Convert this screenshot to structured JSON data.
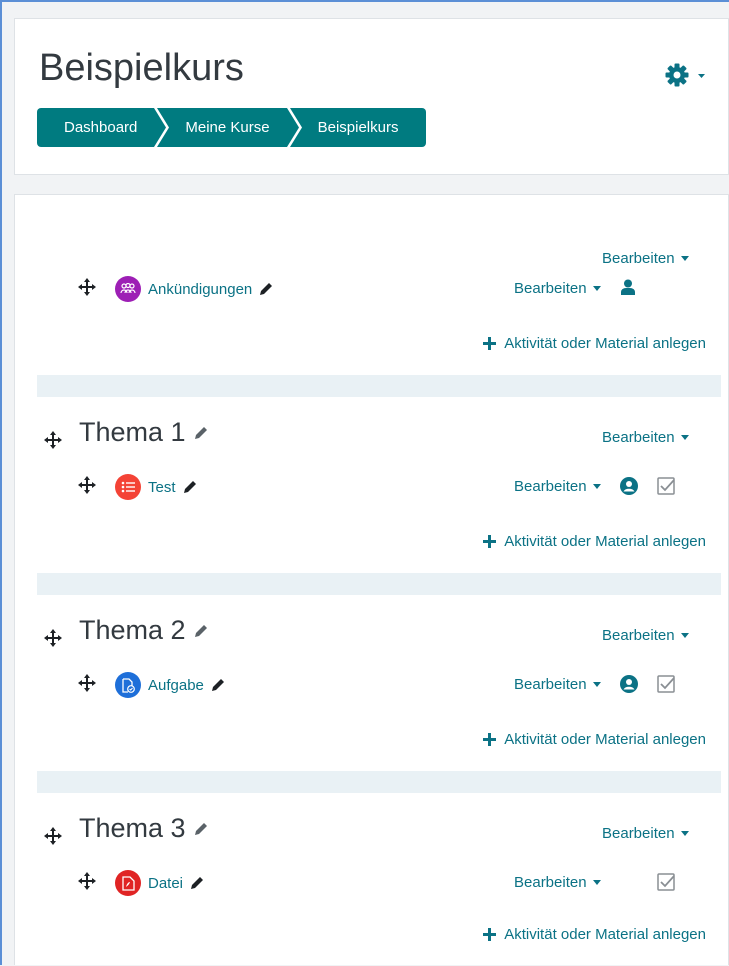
{
  "page": {
    "title": "Beispielkurs"
  },
  "breadcrumb": [
    "Dashboard",
    "Meine Kurse",
    "Beispielkurs"
  ],
  "edit_label": "Bearbeiten",
  "add_label": "Aktivität oder Material anlegen",
  "sections": [
    {
      "title": "",
      "activity": {
        "name": "Ankündigungen",
        "type": "forum",
        "color": "#9d1fb5"
      }
    },
    {
      "title": "Thema 1",
      "activity": {
        "name": "Test",
        "type": "quiz",
        "color": "#f44336"
      }
    },
    {
      "title": "Thema 2",
      "activity": {
        "name": "Aufgabe",
        "type": "assignment",
        "color": "#1e6fd9"
      }
    },
    {
      "title": "Thema 3",
      "activity": {
        "name": "Datei",
        "type": "file",
        "color": "#e02424"
      }
    }
  ],
  "colors": {
    "accent": "#007b80",
    "link": "#0b7285"
  }
}
